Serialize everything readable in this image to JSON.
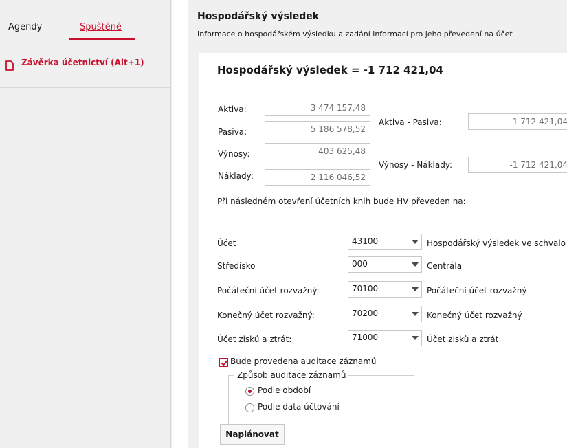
{
  "sidebar": {
    "tabs": [
      {
        "label": "Agendy"
      },
      {
        "label": "Spuštěné"
      }
    ],
    "items": [
      {
        "label": "Závěrka účetnictví (Alt+1)"
      }
    ]
  },
  "header": {
    "title": "Hospodářský výsledek",
    "subtitle": "Informace o hospodářském výsledku a zadání informací pro jeho převedení na účet"
  },
  "summary": {
    "title": "Hospodářský výsledek = -1 712 421,04",
    "aktiva_label": "Aktiva:",
    "aktiva_value": "3 474 157,48",
    "pasiva_label": "Pasiva:",
    "pasiva_value": "5 186 578,52",
    "vynosy_label": "Výnosy:",
    "vynosy_value": "403 625,48",
    "naklady_label": "Náklady:",
    "naklady_value": "2 116 046,52",
    "aktiva_pasiva_label": "Aktiva - Pasiva:",
    "aktiva_pasiva_value": "-1 712 421,04",
    "vynosy_naklady_label": "Výnosy - Náklady:",
    "vynosy_naklady_value": "-1 712 421,04"
  },
  "transfer": {
    "link_text": "Při následném otevření účetních knih bude HV převeden na:",
    "rows": [
      {
        "label": "Účet",
        "value": "43100",
        "description": "Hospodářský výsledek ve schvalo"
      },
      {
        "label": "Středisko",
        "value": "000",
        "description": "Centrála"
      },
      {
        "label": "Počáteční účet rozvažný:",
        "value": "70100",
        "description": "Počáteční účet rozvažný"
      },
      {
        "label": "Konečný účet rozvažný:",
        "value": "70200",
        "description": "Konečný účet rozvažný"
      },
      {
        "label": "Účet zisků a ztrát:",
        "value": "71000",
        "description": "Účet zisků a ztrát"
      }
    ]
  },
  "audit": {
    "checkbox_label": "Bude provedena auditace záznamů",
    "checked": true,
    "group_label": "Způsob auditace záznamů",
    "options": [
      {
        "label": "Podle období",
        "selected": true
      },
      {
        "label": "Podle data účtování",
        "selected": false
      }
    ]
  },
  "actions": {
    "plan_label": "Naplánovat"
  },
  "colors": {
    "accent": "#c8102e",
    "panel_bg": "#f0f0f0",
    "content_bg": "#ffffff"
  }
}
